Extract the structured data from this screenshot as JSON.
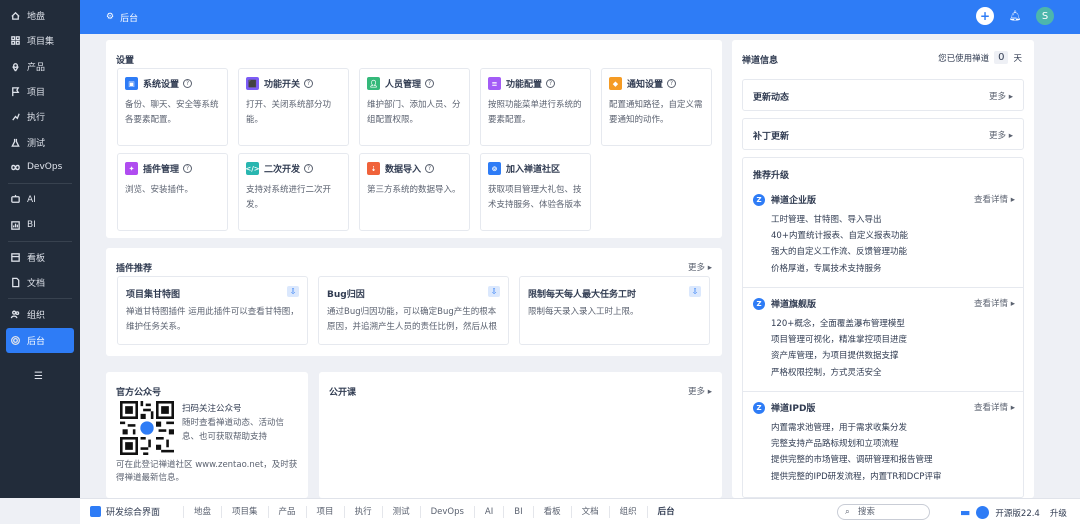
{
  "sidebar": {
    "items": [
      {
        "label": "地盘",
        "icon": "home-icon"
      },
      {
        "label": "项目集",
        "icon": "grid-icon"
      },
      {
        "label": "产品",
        "icon": "location-icon"
      },
      {
        "label": "项目",
        "icon": "flag-icon"
      },
      {
        "label": "执行",
        "icon": "run-icon"
      },
      {
        "label": "测试",
        "icon": "flask-icon"
      },
      {
        "label": "DevOps",
        "icon": "infinity-icon"
      },
      {
        "label": "AI",
        "icon": "ai-icon"
      },
      {
        "label": "BI",
        "icon": "chart-icon"
      },
      {
        "label": "看板",
        "icon": "board-icon"
      },
      {
        "label": "文档",
        "icon": "doc-icon"
      },
      {
        "label": "组织",
        "icon": "people-icon"
      },
      {
        "label": "后台",
        "icon": "gear-icon"
      }
    ]
  },
  "topbar": {
    "title": "后台",
    "avatar": "S"
  },
  "settings": {
    "title": "设置",
    "cards": [
      {
        "name": "系统设置",
        "desc": "备份、聊天、安全等系统各要素配置。",
        "color": "#2e7cf6"
      },
      {
        "name": "功能开关",
        "desc": "打开、关闭系统部分功能。",
        "color": "#7c5cf6"
      },
      {
        "name": "人员管理",
        "desc": "维护部门、添加人员、分组配置权限。",
        "color": "#35b97a"
      },
      {
        "name": "功能配置",
        "desc": "按照功能菜单进行系统的要素配置。",
        "color": "#a35cf6"
      },
      {
        "name": "通知设置",
        "desc": "配置通知路径，自定义需要通知的动作。",
        "color": "#f59b24"
      },
      {
        "name": "插件管理",
        "desc": "浏览、安装插件。",
        "color": "#b04cf0"
      },
      {
        "name": "二次开发",
        "desc": "支持对系统进行二次开发。",
        "color": "#29b6b0"
      },
      {
        "name": "数据导入",
        "desc": "第三方系统的数据导入。",
        "color": "#f0623a"
      },
      {
        "name": "加入禅道社区",
        "desc": "获取项目管理大礼包、技术支持服务、体验各版本",
        "color": "#2e7cf6"
      }
    ]
  },
  "plugins": {
    "title": "插件推荐",
    "more": "更多",
    "items": [
      {
        "name": "项目集甘特图",
        "desc": "禅道甘特图插件 运用此插件可以查看甘特图，维护任务关系。"
      },
      {
        "name": "Bug归因",
        "desc": "通过Bug归因功能，可以确定Bug产生的根本原因，并追溯产生人员的责任比例，然后从根"
      },
      {
        "name": "限制每天每人最大任务工时",
        "desc": "限制每天录入录入工时上限。"
      }
    ]
  },
  "wechat": {
    "title": "官方公众号",
    "line1": "扫码关注公众号",
    "line2": "随时查看禅道动态、活动信息、也可获取帮助支持",
    "footer": "可在此登记禅道社区 www.zentao.net，及时获得禅道最新信息。"
  },
  "course": {
    "title": "公开课",
    "more": "更多"
  },
  "info": {
    "title": "禅道信息",
    "usage_prefix": "您已使用禅道",
    "days": "0",
    "usage_suffix": "天",
    "updates": {
      "title": "更新动态",
      "more": "更多"
    },
    "patches": {
      "title": "补丁更新",
      "more": "更多"
    },
    "upgrade": {
      "title": "推荐升级",
      "editions": [
        {
          "name": "禅道企业版",
          "more": "查看详情",
          "features": [
            "工时管理、甘特图、导入导出",
            "40+内置统计报表、自定义报表功能",
            "强大的自定义工作流、反馈管理功能",
            "价格厚道，专属技术支持服务"
          ]
        },
        {
          "name": "禅道旗舰版",
          "more": "查看详情",
          "features": [
            "120+概念，全面覆盖瀑布管理模型",
            "项目管理可视化，精准掌控项目进度",
            "资产库管理，为项目提供数据支撑",
            "严格权限控制，方式灵活安全"
          ]
        },
        {
          "name": "禅道IPD版",
          "more": "查看详情",
          "features": [
            "内置需求池管理，用于需求收集分发",
            "完整支持产品路标规划和立项流程",
            "提供完整的市场管理、调研管理和报告管理",
            "提供完整的IPD研发流程，内置TR和DCP评审"
          ]
        }
      ]
    }
  },
  "bottombar": {
    "first": "研发综合界面",
    "items": [
      "地盘",
      "项目集",
      "产品",
      "项目",
      "执行",
      "测试",
      "DevOps",
      "AI",
      "BI",
      "看板",
      "文档",
      "组织",
      "后台"
    ],
    "search": "搜索",
    "version": "开源版22.4",
    "upgrade": "升级"
  }
}
